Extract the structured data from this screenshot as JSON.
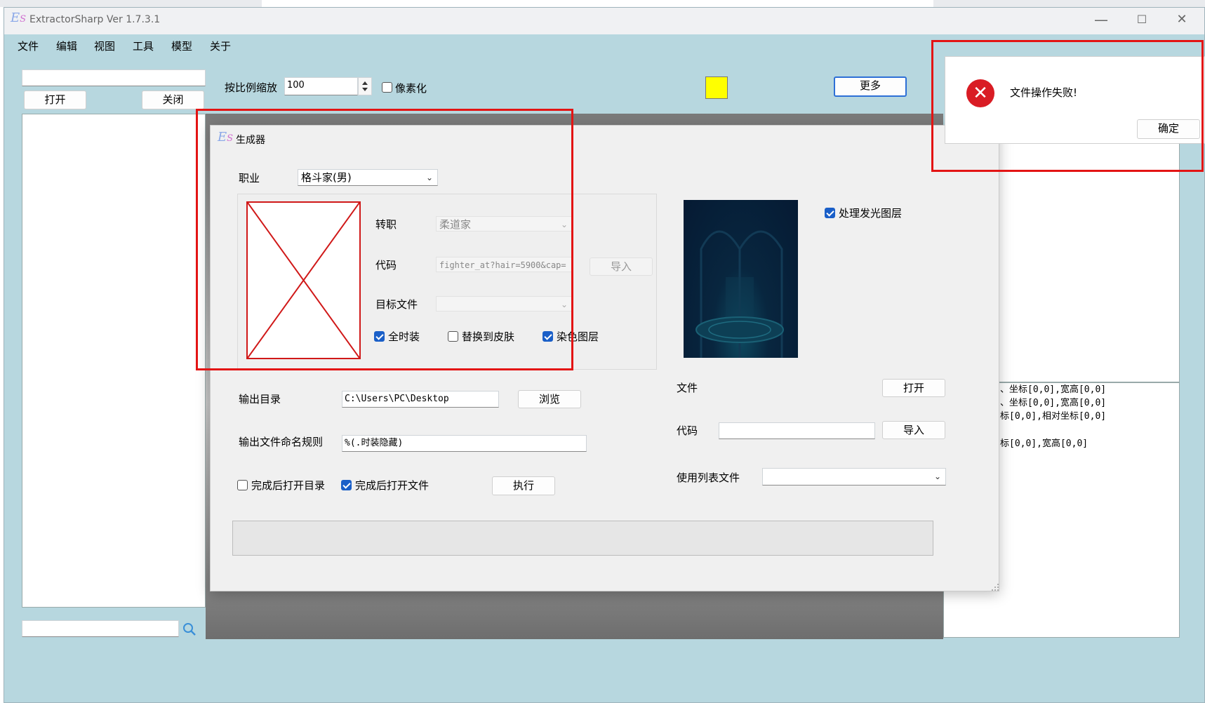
{
  "app": {
    "logo_e": "E",
    "logo_s": "S",
    "title": "ExtractorSharp Ver 1.7.3.1",
    "minimize": "—",
    "maximize": "☐",
    "close": "✕"
  },
  "menu": [
    "文件",
    "编辑",
    "视图",
    "工具",
    "模型",
    "关于"
  ],
  "left_panel": {
    "search_value": "",
    "open_btn": "打开",
    "close_btn": "关闭",
    "bottom_search_value": ""
  },
  "toolbar": {
    "scale_label": "按比例缩放",
    "scale_value": "100",
    "pixelate_label": "像素化",
    "color_swatch": "#ffff00",
    "more_btn": "更多"
  },
  "log_lines": [
    "、坐标[0,0],宽高[0,0]",
    "、坐标[0,0],宽高[0,0]",
    "标[0,0],相对坐标[0,0]",
    "标[0,0],宽高[0,0]"
  ],
  "generator": {
    "title": "生成器",
    "logo_e": "E",
    "logo_s": "S",
    "minimize": "—",
    "maximize": "☐",
    "close": "✕",
    "job_label": "职业",
    "job_value": "格斗家(男)",
    "subjob_label": "转职",
    "subjob_value": "柔道家",
    "code_label": "代码",
    "code_value": "fighter_at?hair=5900&cap=",
    "import_btn_disabled": "导入",
    "target_label": "目标文件",
    "target_value": "",
    "full_costume_label": "全时装",
    "replace_skin_label": "替换到皮肤",
    "dye_layer_label": "染色图层",
    "glow_layer_label": "处理发光图层",
    "output_dir_label": "输出目录",
    "output_dir_value": "C:\\Users\\PC\\Desktop",
    "browse_btn": "浏览",
    "naming_label": "输出文件命名规则",
    "naming_value": "%(.时装隐藏)",
    "open_dir_after_label": "完成后打开目录",
    "open_file_after_label": "完成后打开文件",
    "execute_btn": "执行",
    "file_label": "文件",
    "file_open_btn": "打开",
    "code2_label": "代码",
    "code2_value": "",
    "import_btn": "导入",
    "list_file_label": "使用列表文件",
    "list_file_value": "",
    "progress": 0
  },
  "message_box": {
    "icon": "✕",
    "message": "文件操作失败!",
    "ok_btn": "确定"
  }
}
